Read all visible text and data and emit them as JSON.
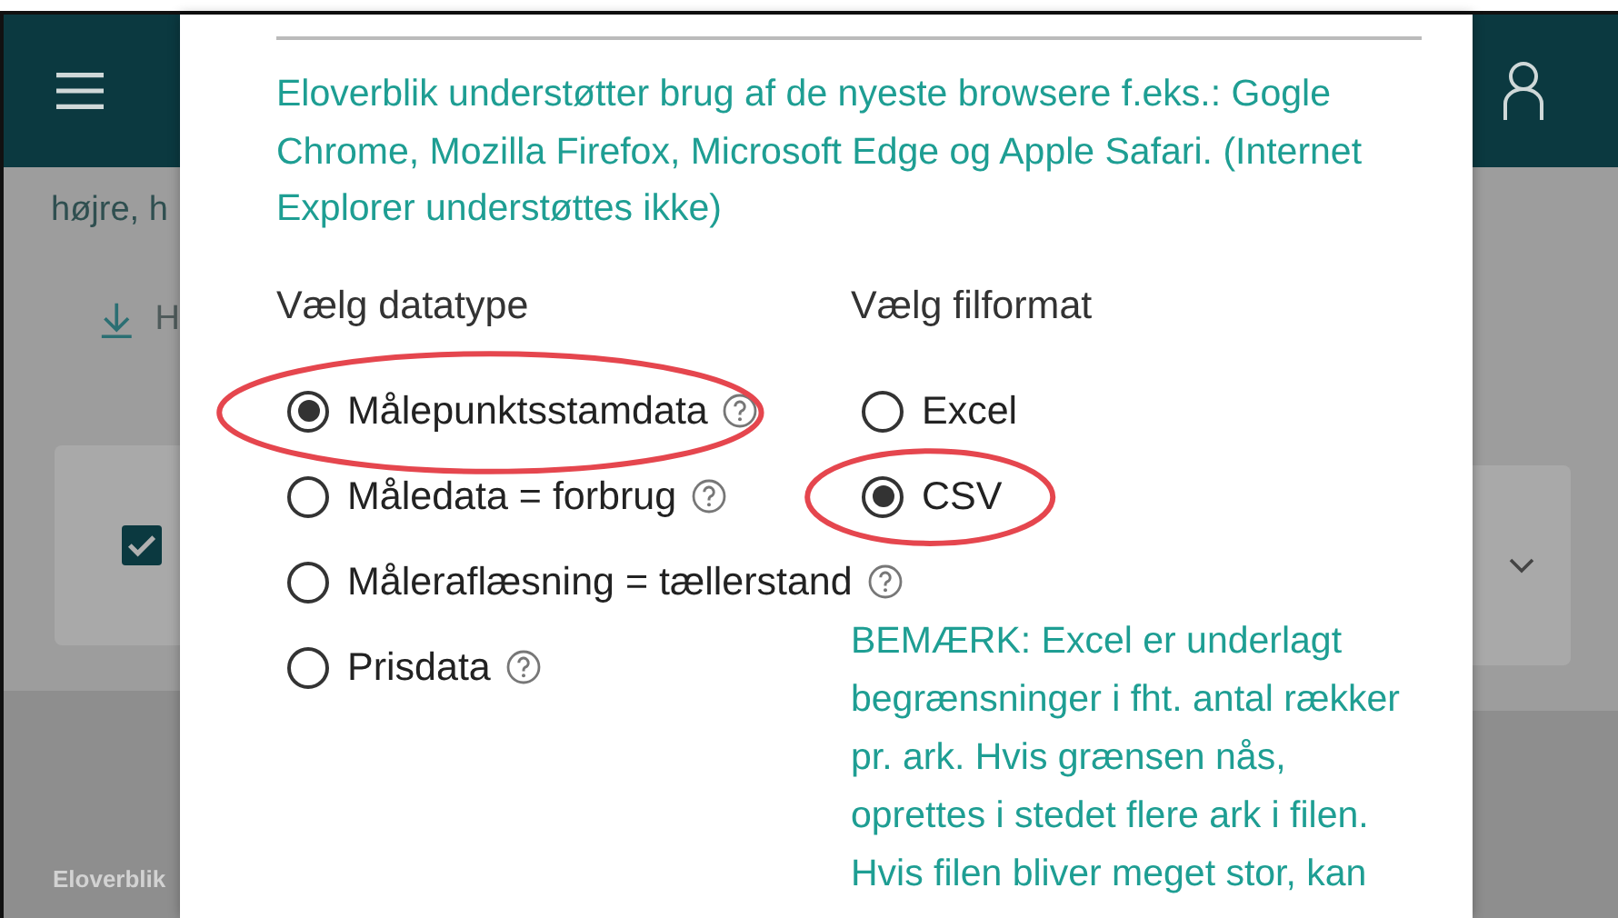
{
  "background": {
    "left_lines": [
      "højre, h"
    ],
    "download_link": "H",
    "card_checkbox": {
      "checked": true
    },
    "footer": "Eloverblik"
  },
  "dialog": {
    "info": "Eloverblik understøtter brug af de nyeste browsere f.eks.: Gogle Chrome, Mozilla Firefox, Microsoft Edge og Apple Safari. (Internet Explorer understøttes ikke)",
    "datatype_label": "Vælg datatype",
    "datatypes": [
      {
        "label": "Målepunktsstamdata",
        "selected": true,
        "help": true,
        "highlighted": true
      },
      {
        "label": "Måledata = forbrug",
        "selected": false,
        "help": true,
        "highlighted": false
      },
      {
        "label": "Måleraflæsning = tællerstand",
        "selected": false,
        "help": true,
        "highlighted": false
      },
      {
        "label": "Prisdata",
        "selected": false,
        "help": true,
        "highlighted": false
      }
    ],
    "format_label": "Vælg filformat",
    "formats": [
      {
        "label": "Excel",
        "selected": false,
        "highlighted": false
      },
      {
        "label": "CSV",
        "selected": true,
        "highlighted": true
      }
    ],
    "note": "BEMÆRK: Excel er underlagt begrænsninger i fht. antal rækker pr. ark. Hvis grænsen nås, oprettes i stedet flere ark i filen. Hvis filen bliver meget stor, kan"
  }
}
